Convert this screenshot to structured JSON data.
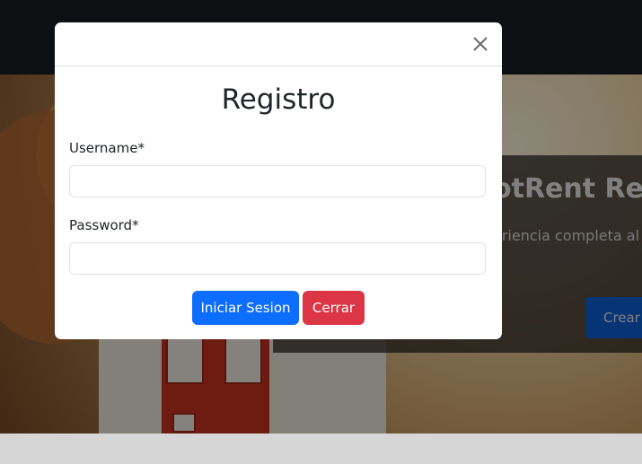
{
  "background": {
    "hero_title": "otRent Reve",
    "hero_subtitle": "eriencia completa al s",
    "hero_button": "Crear"
  },
  "modal": {
    "title": "Registro",
    "close_icon": "close-icon",
    "username_label": "Username*",
    "username_value": "",
    "password_label": "Password*",
    "password_value": "",
    "login_button": "Iniciar Sesion",
    "close_button": "Cerrar"
  },
  "colors": {
    "primary": "#0d6efd",
    "danger": "#dc3545",
    "navbar": "#15181d"
  }
}
